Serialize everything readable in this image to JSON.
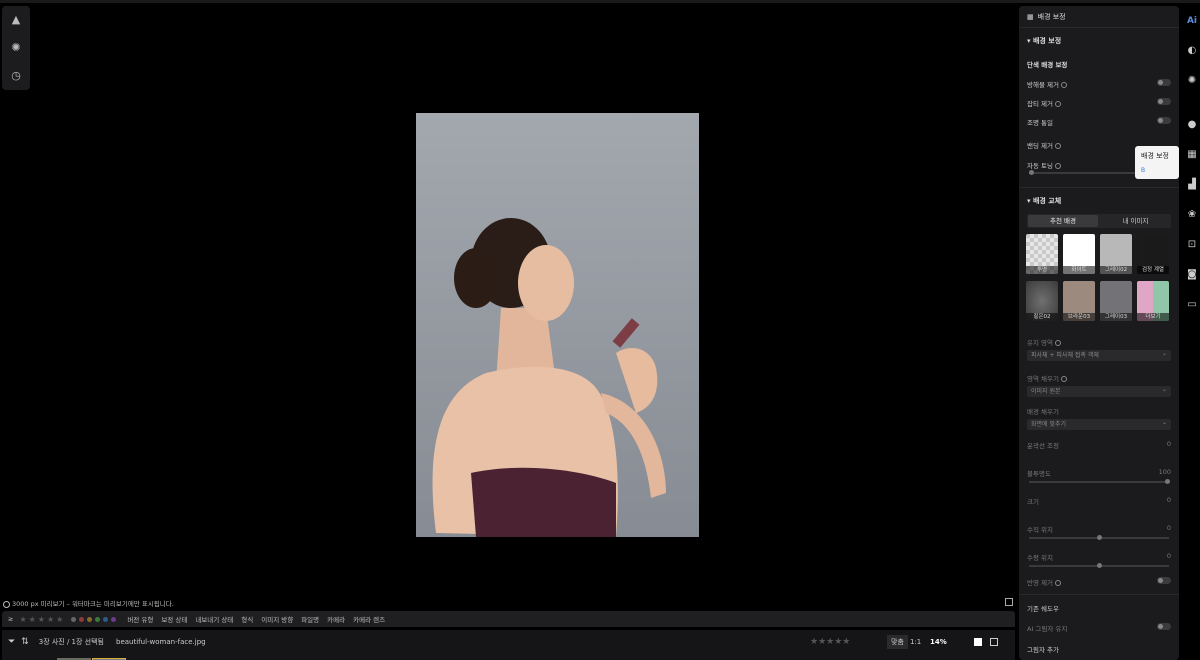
{
  "canvas": {
    "preview_note": "3000 px 미리보기 – 워터마크는 미리보기에만 표시됩니다."
  },
  "left_tools": [
    "mountain-icon",
    "sun-icon",
    "clock-icon"
  ],
  "bottom": {
    "rating_label": "≥",
    "filters": [
      "버전 유형",
      "보정 상태",
      "내보내기 상태",
      "형식",
      "이미지 방향",
      "파일명",
      "카메라",
      "카메라 렌즈"
    ],
    "count_text": "3장 사진 / 1장 선택됨",
    "filename": "beautiful-woman-face.jpg",
    "zoom_fit": "맞춤",
    "zoom_1to1": "1:1",
    "zoom_value": "14%"
  },
  "panel": {
    "header": "배경 보정",
    "section1_title": "배경 보정",
    "sub_title": "단색 배경 보정",
    "toggles": [
      {
        "label": "방해물 제거"
      },
      {
        "label": "잡티 제거"
      },
      {
        "label": "조명 통일"
      },
      {
        "label": "밴딩 제거"
      },
      {
        "label": "자동 토닝"
      }
    ],
    "section2_title": "배경 교체",
    "tab_recommended": "추천 배경",
    "tab_mine": "내 이미지",
    "thumbs": [
      {
        "label": "투명",
        "color": "#d9d9d9"
      },
      {
        "label": "화이트",
        "color": "#ffffff"
      },
      {
        "label": "그레이02",
        "color": "#b8b8b8"
      },
      {
        "label": "검정 계열",
        "color": "#1a1a1a"
      },
      {
        "label": "짙은02",
        "color": "#4a4a4a"
      },
      {
        "label": "브라운03",
        "color": "#9d8a7f"
      },
      {
        "label": "그레이03",
        "color": "#727277"
      },
      {
        "label": "더보기",
        "color": "#c8c0d8"
      }
    ],
    "keep_area_label": "유지 영역",
    "keep_area_value": "피사체 + 피사체 접촉 객체",
    "fill_label": "영역 채우기",
    "fill_value": "이미지 원본",
    "bg_fill_label": "배경 채우기",
    "bg_fill_value": "화면에 맞추기",
    "outline_label": "윤곽선 조정",
    "outline_value": "0",
    "opacity_label": "불투명도",
    "opacity_value": "100",
    "size_label": "크기",
    "size_value": "0",
    "vpos_label": "수직 위치",
    "vpos_value": "0",
    "hpos_label": "수평 위치",
    "hpos_value": "0",
    "reflect_label": "반영 제거",
    "shadow_label": "기존 쉐도우",
    "ai_shadow_label": "AI 그림자 유지",
    "add_shadow_label": "그림자 추가"
  },
  "tooltip": {
    "title": "배경 보정",
    "shortcut": "B"
  }
}
